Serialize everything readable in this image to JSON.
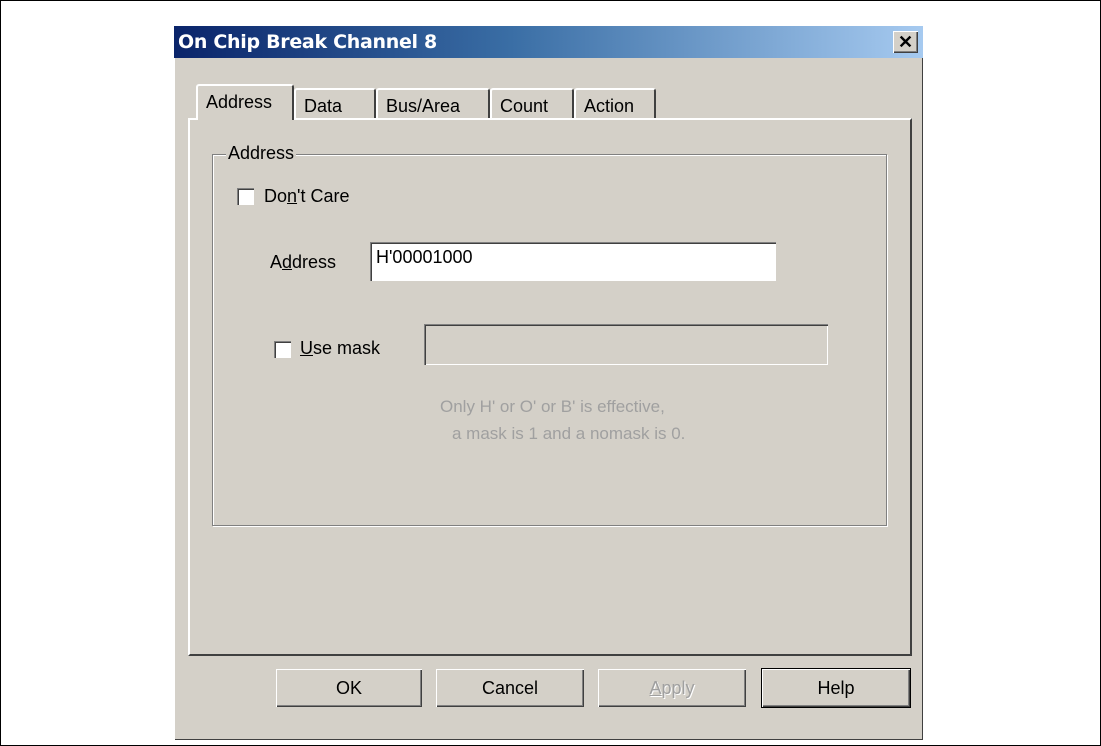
{
  "dialog": {
    "title": "On Chip Break Channel 8",
    "close_glyph": "✕"
  },
  "tabs": [
    {
      "label": "Address",
      "active": true
    },
    {
      "label": "Data",
      "active": false
    },
    {
      "label": "Bus/Area",
      "active": false
    },
    {
      "label": "Count",
      "active": false
    },
    {
      "label": "Action",
      "active": false
    }
  ],
  "address_group": {
    "label": "Address",
    "dont_care": {
      "pre": "Do",
      "accel": "n",
      "post": "'t Care",
      "checked": false
    },
    "address_field": {
      "pre": "A",
      "accel": "d",
      "post": "dress",
      "value": "H'00001000"
    },
    "use_mask": {
      "accel": "U",
      "post": "se mask",
      "checked": false,
      "value": ""
    },
    "hint_line1": "Only H' or O' or B' is effective,",
    "hint_line2": "a mask is 1 and a nomask is 0."
  },
  "buttons": {
    "ok": "OK",
    "cancel": "Cancel",
    "apply_accel": "A",
    "apply_rest": "pply",
    "help": "Help"
  }
}
